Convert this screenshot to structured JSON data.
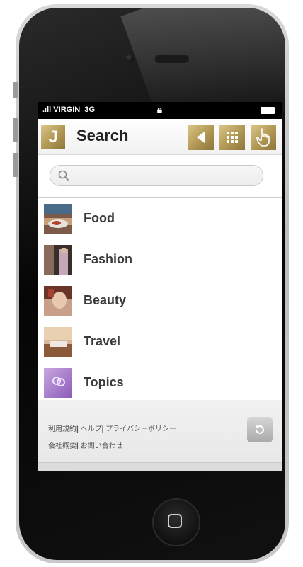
{
  "status": {
    "carrier": "VIRGIN",
    "network": "3G"
  },
  "header": {
    "logo": "J",
    "title": "Search"
  },
  "search": {
    "placeholder": "",
    "value": ""
  },
  "categories": [
    {
      "label": "Food"
    },
    {
      "label": "Fashion"
    },
    {
      "label": "Beauty"
    },
    {
      "label": "Travel"
    },
    {
      "label": "Topics"
    }
  ],
  "footer": {
    "link_terms": "利用規約",
    "link_help": "ヘルプ",
    "link_privacy": "プライバシーポリシー",
    "link_company": "会社概要",
    "link_contact": "お問い合わせ"
  },
  "colors": {
    "accent_gold": "#b49a56"
  }
}
